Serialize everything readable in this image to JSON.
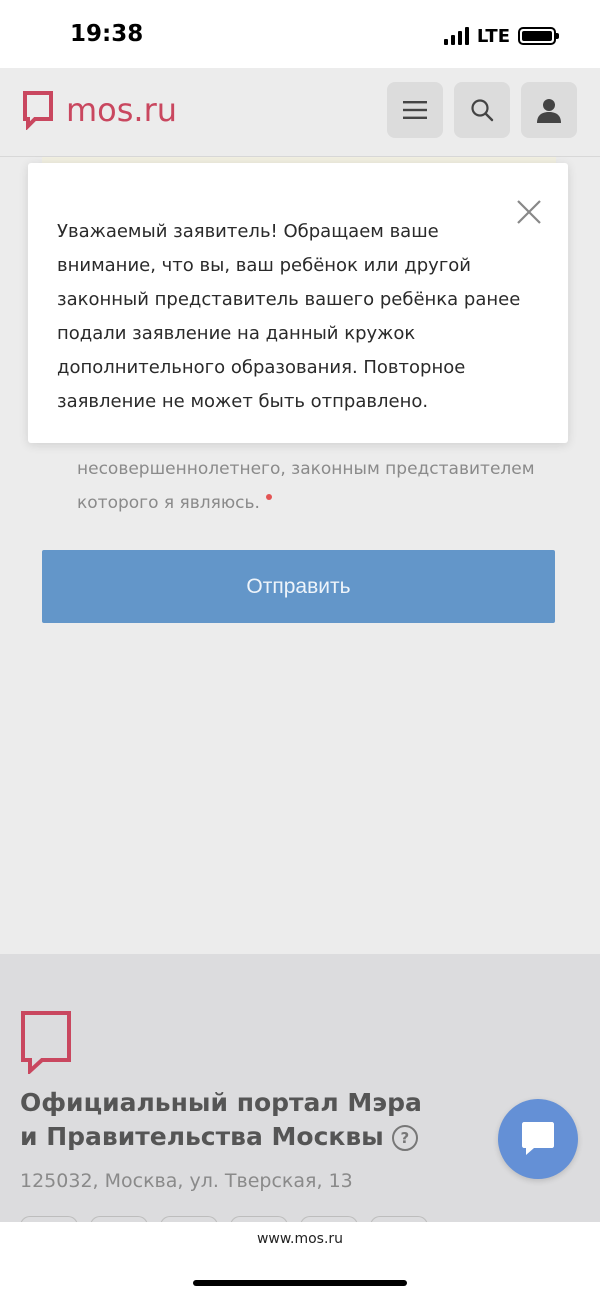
{
  "status_bar": {
    "time": "19:38",
    "network": "LTE"
  },
  "header": {
    "logo_text": "mos.ru",
    "menu_icon": "hamburger-icon",
    "search_icon": "search-icon",
    "profile_icon": "user-icon"
  },
  "modal": {
    "text": "Уважаемый заявитель! Обращаем ваше внимание, что вы, ваш ребёнок или другой законный представитель вашего ребёнка ранее подали заявление на данный кружок дополнительного образования. Повторное заявление не может быть отправлено.",
    "close_icon": "close-icon"
  },
  "form": {
    "consent_text_line1": "несовершеннолетнего, законным представителем",
    "consent_text_line2": "которого я являюсь.",
    "submit_label": "Отправить"
  },
  "footer": {
    "title_line1": "Официальный портал Мэра",
    "title_line2": "и Правительства Москвы",
    "help_symbol": "?",
    "address": "125032, Москва, ул. Тверская, 13"
  },
  "chat": {
    "icon": "chat-icon"
  },
  "browser": {
    "url": "www.mos.ru"
  },
  "colors": {
    "brand": "#c9475f",
    "button": "#6396c9",
    "chat": "#6490d6"
  }
}
